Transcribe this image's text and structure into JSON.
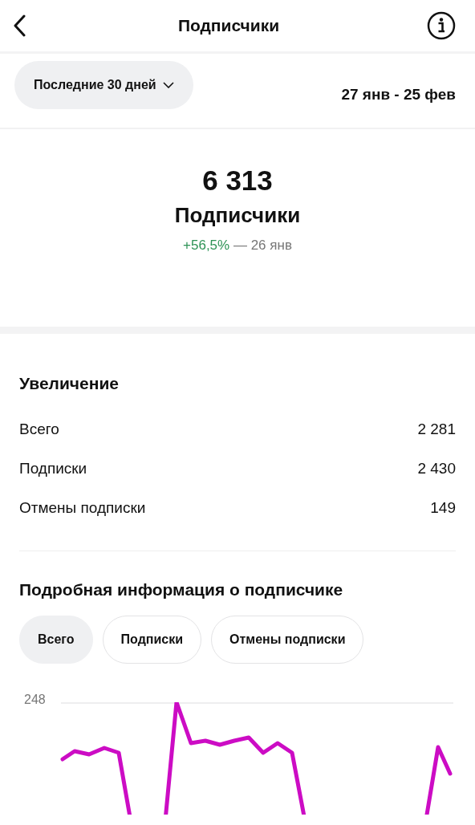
{
  "header": {
    "title": "Подписчики"
  },
  "filter": {
    "period": "Последние 30 дней",
    "range": "27 янв - 25 фев"
  },
  "summary": {
    "value": "6 313",
    "label": "Подписчики",
    "change": "+56,5%",
    "since": "— 26 янв"
  },
  "growth": {
    "title": "Увеличение",
    "rows": [
      {
        "label": "Всего",
        "value": "2 281"
      },
      {
        "label": "Подписки",
        "value": "2 430"
      },
      {
        "label": "Отмены подписки",
        "value": "149"
      }
    ]
  },
  "details": {
    "title": "Подробная информация о подписчике",
    "tabs": [
      {
        "label": "Всего",
        "selected": true
      },
      {
        "label": "Подписки",
        "selected": false
      },
      {
        "label": "Отмены подписки",
        "selected": false
      }
    ],
    "chart": {
      "tick_label": "248"
    }
  }
}
